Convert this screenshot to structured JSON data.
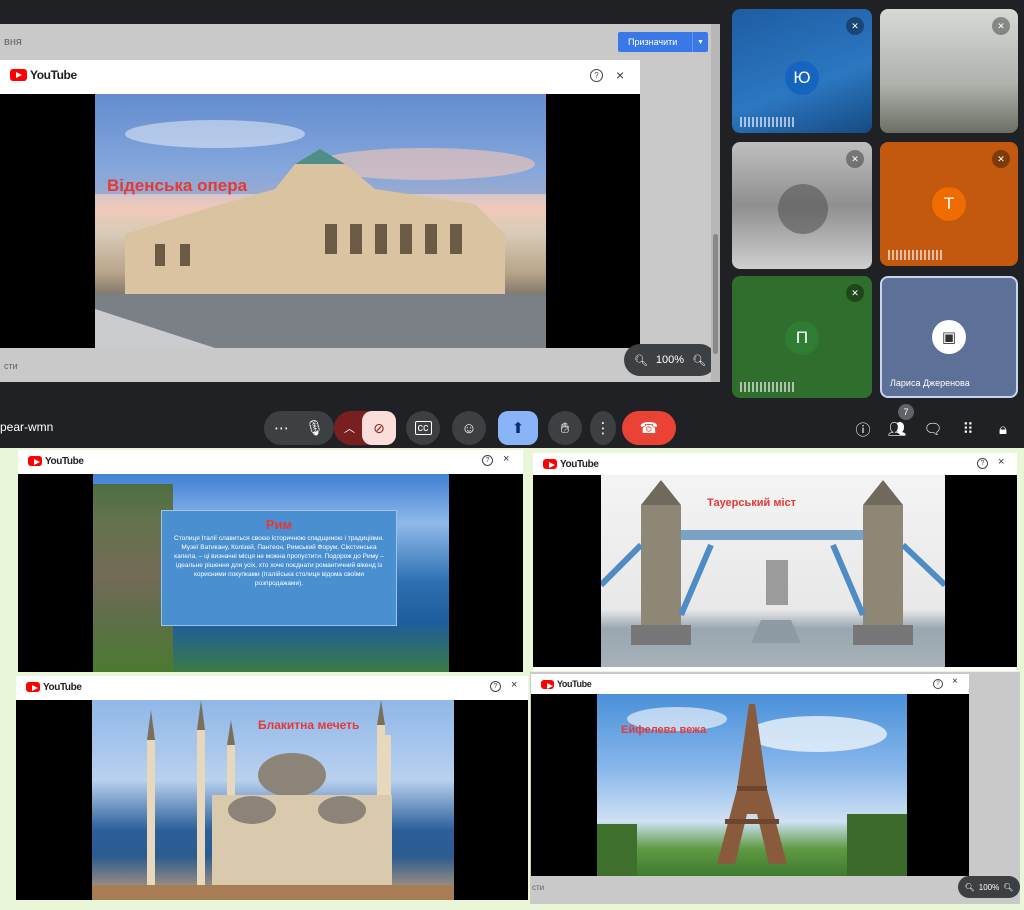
{
  "classroom": {
    "tab_fragment": "вня",
    "assign_button": "Призначити",
    "bottom_fragment": "сти"
  },
  "youtube": {
    "logo_text": "YouTube",
    "help": "?",
    "close": "×"
  },
  "shared_slide": {
    "title": "Віденська опера"
  },
  "zoom": {
    "level": "100%",
    "minus": "−",
    "plus": "+"
  },
  "tiles": [
    {
      "initial": "Ю",
      "color": "#1a5fa8",
      "avatar_color": "#1565c0"
    },
    {
      "initial": "",
      "color": "#9aa39b"
    },
    {
      "initial": "",
      "color": "#8a8f8c"
    },
    {
      "initial": "Т",
      "color": "#c0580d",
      "avatar_color": "#ef6c00"
    },
    {
      "initial": "П",
      "color": "#2e6b2c",
      "avatar_color": "#2e7d32"
    },
    {
      "initial": "",
      "color": "#5b6e95",
      "name": "Лариса Джеренова"
    }
  ],
  "controls": {
    "meeting_code": "pear-wmn",
    "participants_count": "7"
  },
  "collage": [
    {
      "title": "Рим",
      "body": "Столиця Італії славиться своєю історичною спадщиною і традиціями. Музеї Ватикану, Колізей, Пантеон, Римський Форум, Сікстинська капела, – ці визначні місця не можна пропустити. Подорож до Риму – ідеальне рішення для усіх, хто хоче поєднати романтичний вікенд із корисними покупками (італійська столиця відома своїми розпродажами)."
    },
    {
      "title": "Тауерський міст"
    },
    {
      "title": "Блакитна мечеть"
    },
    {
      "title": "Ейфелева вежа"
    }
  ],
  "collage_zoom": {
    "level": "100%"
  },
  "collage_bottom_fragment": "сти"
}
